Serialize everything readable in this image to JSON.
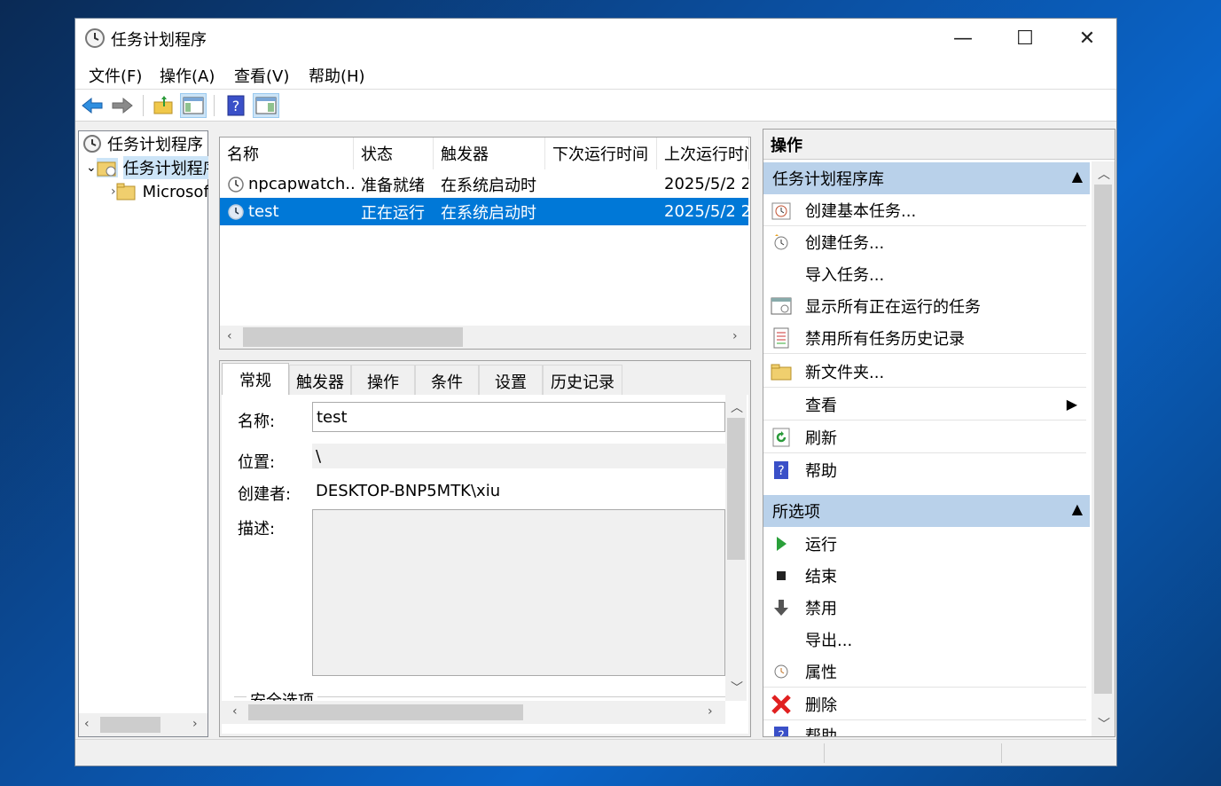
{
  "window": {
    "title": "任务计划程序",
    "minimize_glyph": "—",
    "maximize_glyph": "☐",
    "close_glyph": "✕"
  },
  "menu": [
    "文件(F)",
    "操作(A)",
    "查看(V)",
    "帮助(H)"
  ],
  "toolbar": {
    "icons": [
      "back-arrow-icon",
      "forward-arrow-icon",
      "up-folder-icon",
      "show-tree-icon",
      "help-icon",
      "show-action-pane-icon"
    ]
  },
  "tree": {
    "root": "任务计划程序",
    "library": "任务计划程序库",
    "child": "Microsoft"
  },
  "task_list": {
    "columns": [
      "名称",
      "状态",
      "触发器",
      "下次运行时间",
      "上次运行时间"
    ],
    "rows": [
      {
        "name": "npcapwatch...",
        "status": "准备就绪",
        "trigger": "在系统启动时",
        "next": "",
        "last": "2025/5/2 2"
      },
      {
        "name": "test",
        "status": "正在运行",
        "trigger": "在系统启动时",
        "next": "",
        "last": "2025/5/2 2"
      }
    ]
  },
  "detail": {
    "tabs": [
      "常规",
      "触发器",
      "操作",
      "条件",
      "设置",
      "历史记录"
    ],
    "name_label": "名称:",
    "name_value": "test",
    "location_label": "位置:",
    "location_value": "\\",
    "author_label": "创建者:",
    "author_value": "DESKTOP-BNP5MTK\\xiu",
    "desc_label": "描述:",
    "security_label": "安全选项"
  },
  "actions": {
    "header": "操作",
    "section1": {
      "title": "任务计划程序库",
      "items": [
        "创建基本任务...",
        "创建任务...",
        "导入任务...",
        "显示所有正在运行的任务",
        "禁用所有任务历史记录",
        "新文件夹...",
        "查看",
        "刷新",
        "帮助"
      ]
    },
    "section2": {
      "title": "所选项",
      "items": [
        "运行",
        "结束",
        "禁用",
        "导出...",
        "属性",
        "删除",
        "帮助"
      ]
    }
  },
  "colors": {
    "selection": "#0078d7",
    "section_header": "#b9d1ea"
  }
}
